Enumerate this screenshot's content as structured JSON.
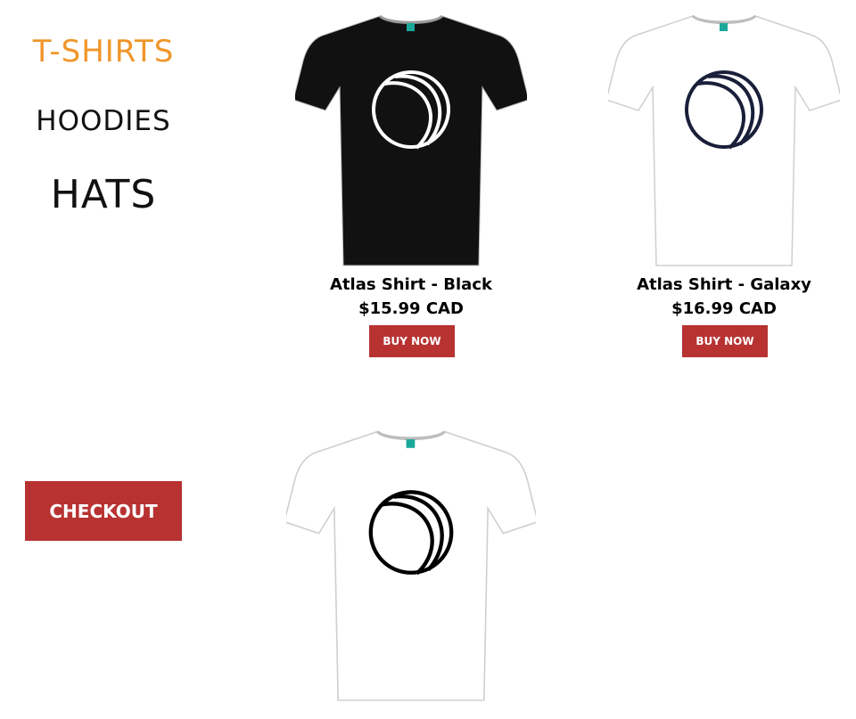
{
  "nav": {
    "tshirts": "T-SHIRTS",
    "hoodies": "HOODIES",
    "hats": "HATS"
  },
  "checkout": {
    "label": "CHECKOUT"
  },
  "products": [
    {
      "name": "Atlas Shirt - Black",
      "price": "$15.99 CAD",
      "button": "BUY NOW",
      "shirt_color": "#111111",
      "logo_color": "#ffffff"
    },
    {
      "name": "Atlas Shirt - Galaxy",
      "price": "$16.99 CAD",
      "button": "BUY NOW",
      "shirt_color": "#ffffff",
      "logo_color": "#1a1f3a"
    },
    {
      "shirt_color": "#ffffff",
      "logo_color": "#000000"
    }
  ],
  "colors": {
    "accent_orange": "#f0962a",
    "button_red": "#b83232",
    "tag_teal": "#1aa89a"
  }
}
